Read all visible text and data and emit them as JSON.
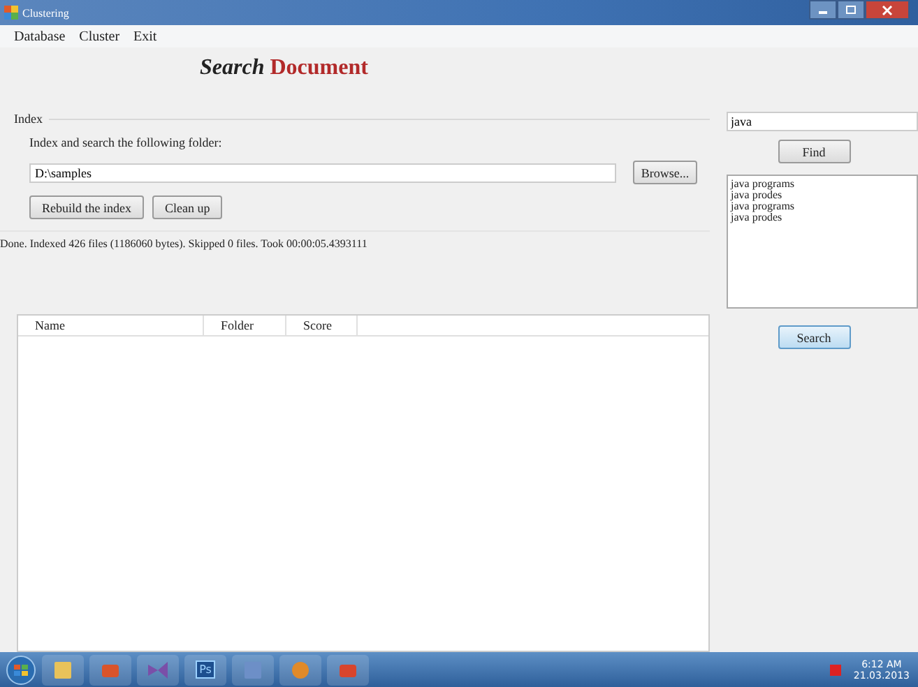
{
  "window": {
    "title": "Clustering"
  },
  "menu": [
    "Database",
    "Cluster",
    "Exit"
  ],
  "logo": {
    "first": "Search",
    "second": "Document"
  },
  "index": {
    "group_label": "Index",
    "instruction": "Index and search the following folder:",
    "folder": "D:\\samples",
    "browse_button": "Browse...",
    "buttons": [
      "Rebuild the index",
      "Clean up"
    ],
    "status": "Done. Indexed 426 files (1186060 bytes). Skipped 0 files. Took 00:00:05.4393111"
  },
  "results": {
    "columns": [
      "Name",
      "Folder",
      "Score"
    ]
  },
  "query": {
    "value": "java"
  },
  "find_button": "Find",
  "suggestions": [
    "java programs",
    "java prodes",
    "java programs",
    "java prodes"
  ],
  "search_button": "Search",
  "taskbar": {
    "apps": [
      {
        "kind": "folder"
      },
      {
        "kind": "mail"
      },
      {
        "kind": "studio"
      },
      {
        "kind": "ps",
        "label": "Ps"
      },
      {
        "kind": "doc"
      },
      {
        "kind": "paint"
      },
      {
        "kind": "office"
      }
    ],
    "time": "6:12 AM",
    "date": "21.03.2013"
  }
}
